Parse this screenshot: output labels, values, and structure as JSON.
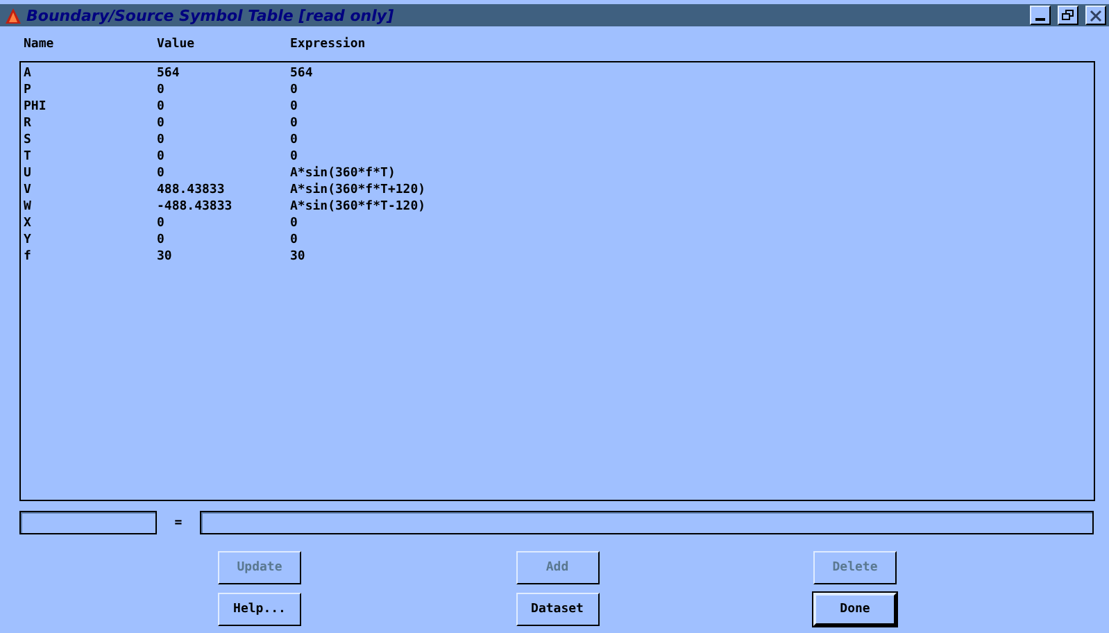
{
  "window": {
    "title": "Boundary/Source Symbol Table [read only]"
  },
  "table": {
    "columns": [
      "Name",
      "Value",
      "Expression"
    ],
    "rows": [
      [
        "A",
        "564",
        "564"
      ],
      [
        "P",
        "0",
        "0"
      ],
      [
        "PHI",
        "0",
        "0"
      ],
      [
        "R",
        "0",
        "0"
      ],
      [
        "S",
        "0",
        "0"
      ],
      [
        "T",
        "0",
        "0"
      ],
      [
        "U",
        "0",
        "A*sin(360*f*T)"
      ],
      [
        "V",
        "488.43833",
        "A*sin(360*f*T+120)"
      ],
      [
        "W",
        "-488.43833",
        "A*sin(360*f*T-120)"
      ],
      [
        "X",
        "0",
        "0"
      ],
      [
        "Y",
        "0",
        "0"
      ],
      [
        "f",
        "30",
        "30"
      ]
    ]
  },
  "editor": {
    "equals": "="
  },
  "buttons": [
    {
      "label": "Update",
      "disabled": true,
      "default": false
    },
    {
      "label": "Add",
      "disabled": true,
      "default": false
    },
    {
      "label": "Delete",
      "disabled": true,
      "default": false
    },
    {
      "label": "Help...",
      "disabled": false,
      "default": false
    },
    {
      "label": "Dataset",
      "disabled": false,
      "default": false
    },
    {
      "label": "Done",
      "disabled": false,
      "default": true
    }
  ]
}
